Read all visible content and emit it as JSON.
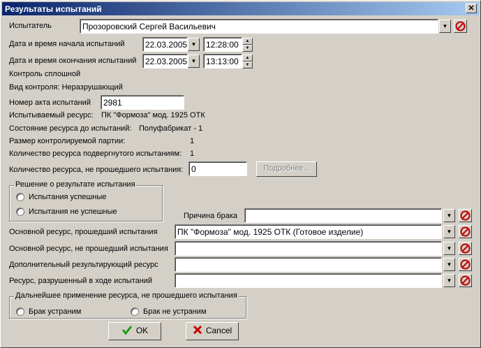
{
  "title": "Результаты испытаний",
  "tester": {
    "label": "Испытатель",
    "value": "Прозоровский Сергей Васильевич"
  },
  "start": {
    "label": "Дата и время начала испытаний",
    "date": "22.03.2005",
    "time": "12:28:00"
  },
  "end": {
    "label": "Дата и время окончания испытаний",
    "date": "22.03.2005",
    "time": "13:13:00"
  },
  "control": "Контроль сплошной",
  "control_type": "Вид контроля: Неразрушающий",
  "act": {
    "label": "Номер акта испытаний",
    "value": "2981"
  },
  "resource": {
    "label": "Испытываемый ресурс:",
    "value": "ПК \"Формоза\" мод. 1925 ОТК"
  },
  "state": {
    "label": "Состояние ресурса до испытаний:",
    "value": "Полуфабрикат - 1"
  },
  "lot_size": {
    "label": "Размер контролируемой партии:",
    "value": "1"
  },
  "tested_qty": {
    "label": "Количество ресурса подвергнутого испытаниям:",
    "value": "1"
  },
  "failed_qty": {
    "label": "Количество ресурса, не прошедшего испытания:",
    "value": "0",
    "details_button": "Подробнее..."
  },
  "decision": {
    "caption": "Решение о результате испытания",
    "success": "Испытания успешные",
    "failure": "Испытания не успешные"
  },
  "defect_reason": {
    "label": "Причина брака",
    "value": ""
  },
  "main_passed": {
    "label": "Основной ресурс, прошедший испытания",
    "value": "ПК \"Формоза\" мод. 1925 ОТК (Готовое изделие)"
  },
  "main_failed": {
    "label": "Основной ресурс, не прошедший испытания",
    "value": ""
  },
  "additional": {
    "label": "Дополнительный результирующий ресурс",
    "value": ""
  },
  "destroyed": {
    "label": "Ресурс, разрушенный в ходе испытаний",
    "value": ""
  },
  "further": {
    "caption": "Дальнейшее применение ресурса, не прошедшего испытания",
    "fixable": "Брак устраним",
    "unfixable": "Брак не устраним"
  },
  "buttons": {
    "ok": "OK",
    "cancel": "Cancel"
  },
  "colors": {
    "title_start": "#0a246a",
    "title_end": "#a6caf0",
    "ok_check": "#1a9a1a",
    "cancel_x": "#c00000",
    "no_icon": "#c00000"
  }
}
